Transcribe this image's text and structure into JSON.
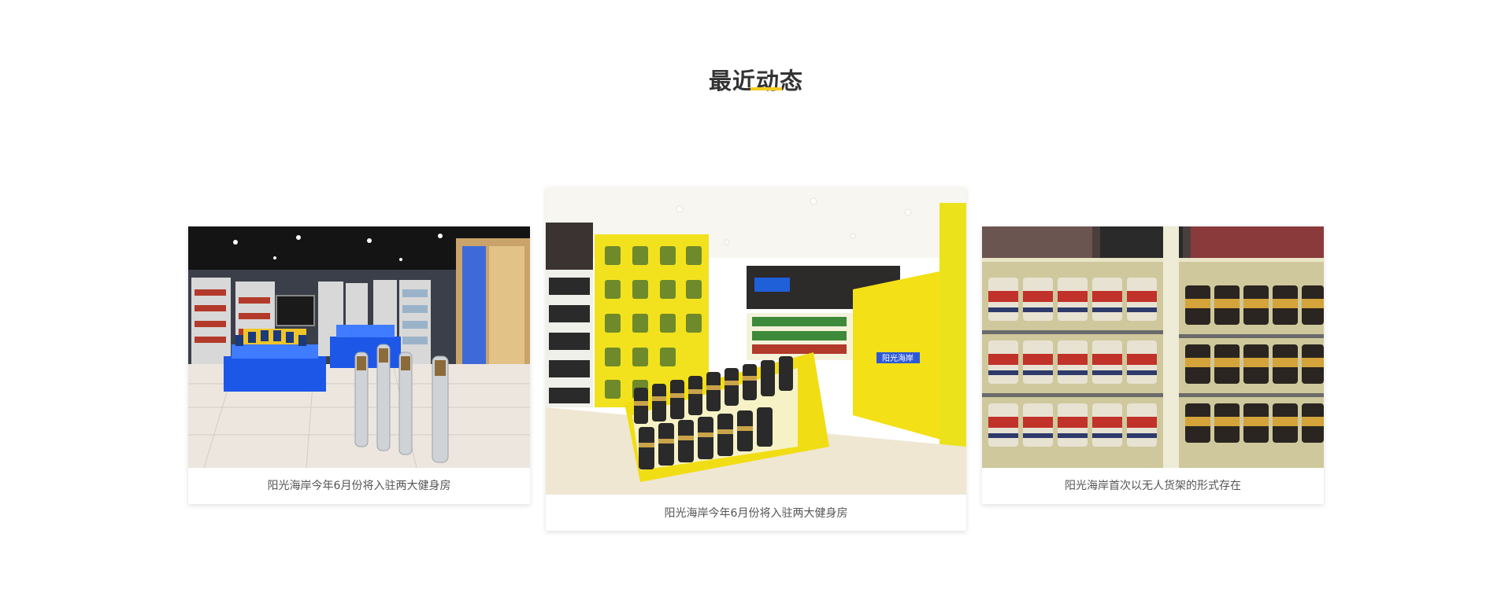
{
  "section": {
    "title": "最近动态",
    "accent_color": "#f5cc1c"
  },
  "news": [
    {
      "caption": "阳光海岸今年6月份将入驻两大健身房",
      "image_icon": "store-interior-blue-display-photo"
    },
    {
      "caption": "阳光海岸今年6月份将入驻两大健身房",
      "image_icon": "store-interior-yellow-shelves-photo",
      "image_sign_text": "阳光海岸"
    },
    {
      "caption": "阳光海岸首次以无人货架的形式存在",
      "image_icon": "supplement-shelf-closeup-photo"
    }
  ]
}
